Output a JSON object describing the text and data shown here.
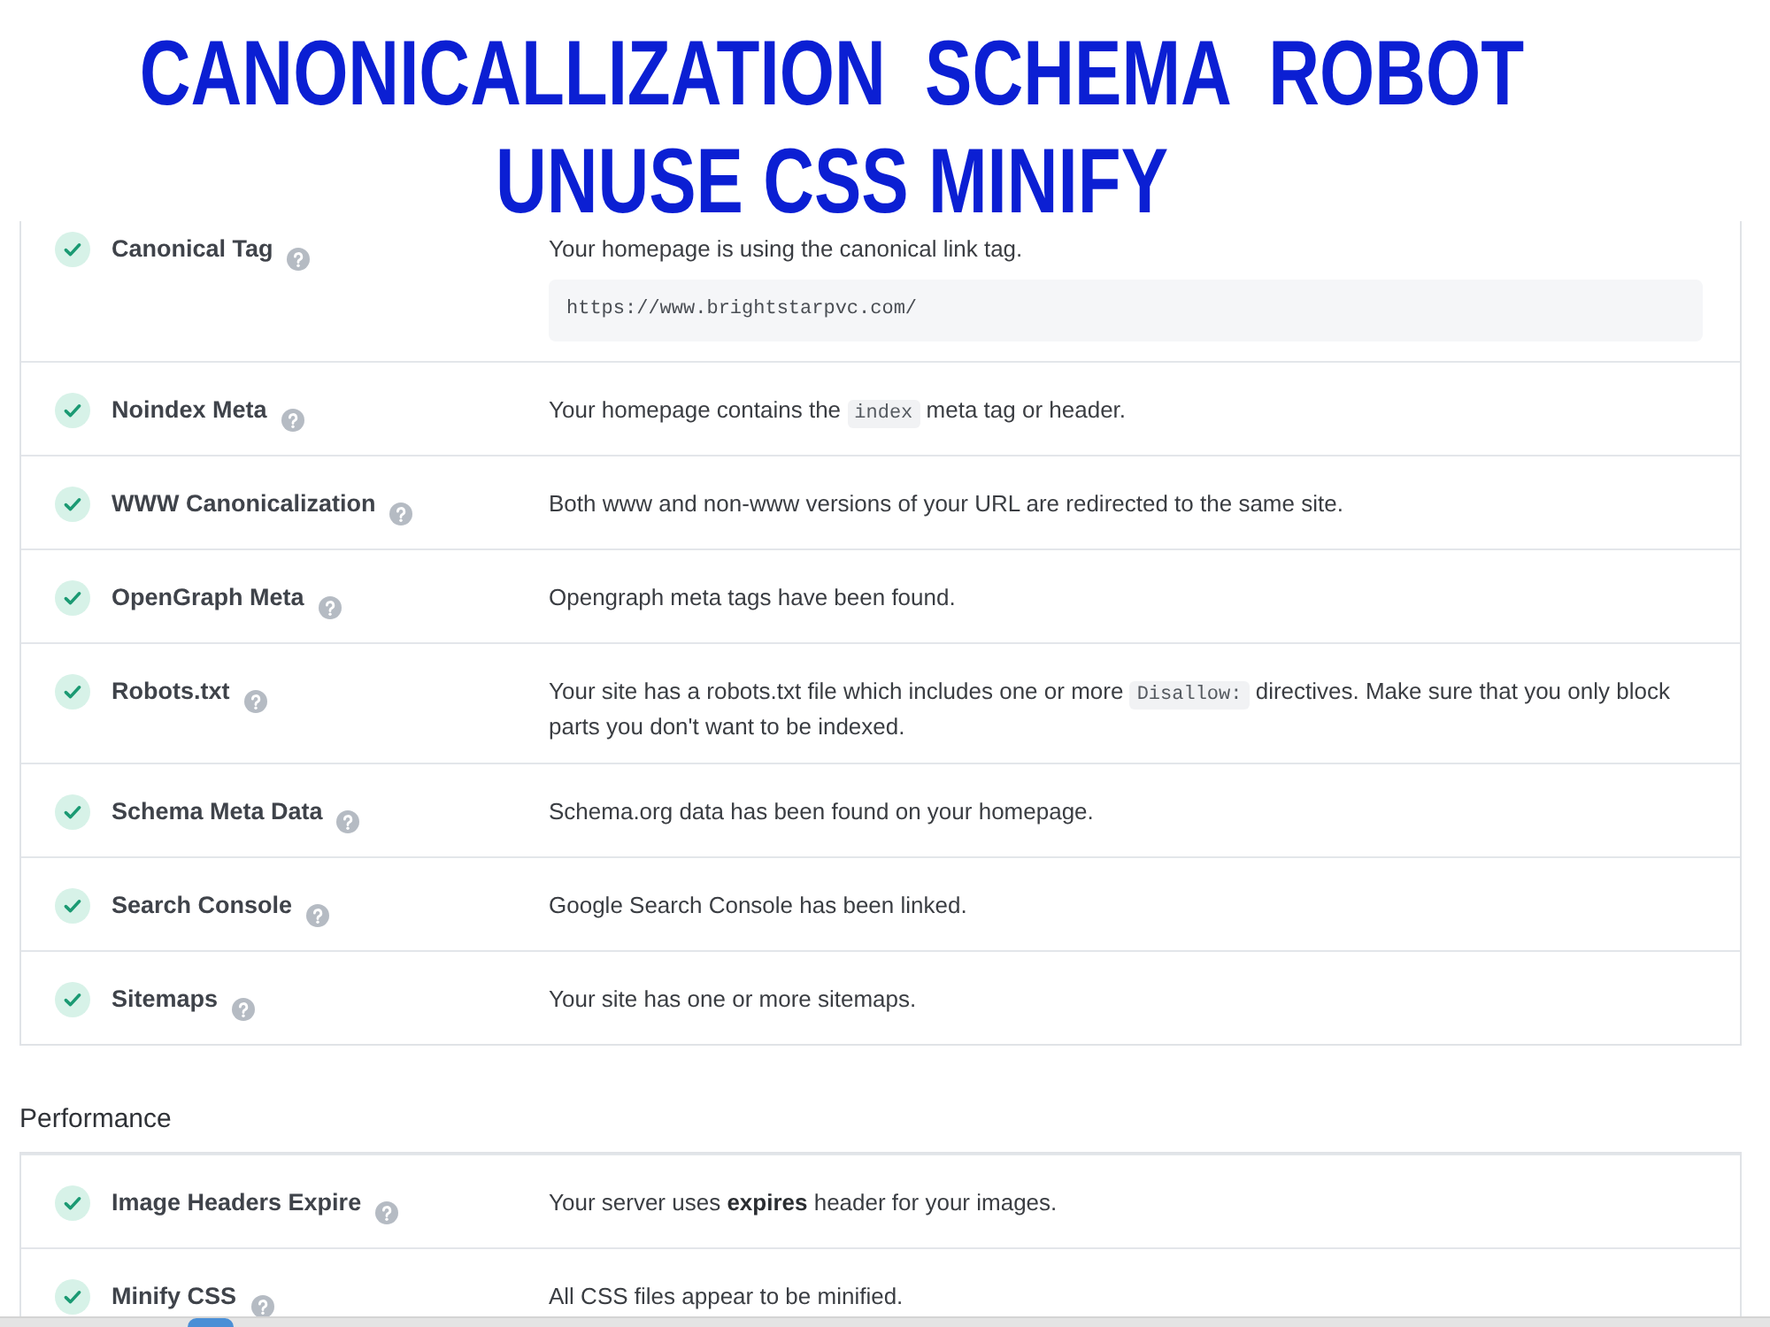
{
  "banner": {
    "lines": [
      "CANONICALLIZATION  SCHEMA  ROBOT",
      "UNUSE CSS MINIFY"
    ]
  },
  "sections": [
    {
      "checks": [
        {
          "passed": true,
          "label": "Canonical Tag",
          "description": [
            {
              "kind": "text",
              "text": "Your homepage is using the canonical link tag."
            }
          ],
          "code_block": "https://www.brightstarpvc.com/"
        },
        {
          "passed": true,
          "label": "Noindex Meta",
          "description": [
            {
              "kind": "text",
              "text": "Your homepage contains the "
            },
            {
              "kind": "code",
              "text": "index"
            },
            {
              "kind": "text",
              "text": " meta tag or header."
            }
          ]
        },
        {
          "passed": true,
          "label": "WWW Canonicalization",
          "description": [
            {
              "kind": "text",
              "text": "Both www and non-www versions of your URL are redirected to the same site."
            }
          ]
        },
        {
          "passed": true,
          "label": "OpenGraph Meta",
          "description": [
            {
              "kind": "text",
              "text": "Opengraph meta tags have been found."
            }
          ]
        },
        {
          "passed": true,
          "label": "Robots.txt",
          "description": [
            {
              "kind": "text",
              "text": "Your site has a robots.txt file which includes one or more "
            },
            {
              "kind": "code",
              "text": "Disallow:"
            },
            {
              "kind": "text",
              "text": " directives. Make sure that you only block parts you don't want to be indexed."
            }
          ]
        },
        {
          "passed": true,
          "label": "Schema Meta Data",
          "description": [
            {
              "kind": "text",
              "text": "Schema.org data has been found on your homepage."
            }
          ]
        },
        {
          "passed": true,
          "label": "Search Console",
          "description": [
            {
              "kind": "text",
              "text": "Google Search Console has been linked."
            }
          ]
        },
        {
          "passed": true,
          "label": "Sitemaps",
          "description": [
            {
              "kind": "text",
              "text": "Your site has one or more sitemaps."
            }
          ]
        }
      ]
    },
    {
      "heading": "Performance",
      "checks": [
        {
          "passed": true,
          "label": "Image Headers Expire",
          "description": [
            {
              "kind": "text",
              "text": "Your server uses **expires** header for your images."
            }
          ]
        },
        {
          "passed": true,
          "label": "Minify CSS",
          "description": [
            {
              "kind": "text",
              "text": "All CSS files appear to be minified."
            }
          ]
        }
      ]
    }
  ]
}
